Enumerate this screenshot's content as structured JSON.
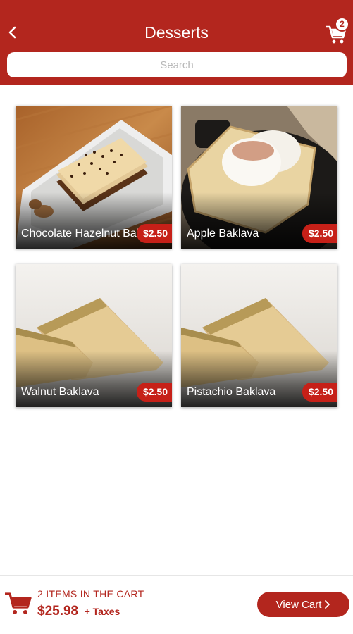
{
  "header": {
    "title": "Desserts",
    "back_icon": "chevron-left-icon",
    "cart_icon": "shopping-cart-icon",
    "cart_count": "2"
  },
  "search": {
    "placeholder": "Search",
    "value": ""
  },
  "products": [
    {
      "name": "Chocolate Hazelnut Baklava",
      "price": "$2.50",
      "image": "chocolate-hazelnut-baklava-photo"
    },
    {
      "name": "Apple Baklava",
      "price": "$2.50",
      "image": "apple-baklava-photo"
    },
    {
      "name": "Walnut Baklava",
      "price": "$2.50",
      "image": "walnut-baklava-photo"
    },
    {
      "name": "Pistachio Baklava",
      "price": "$2.50",
      "image": "pistachio-baklava-photo"
    }
  ],
  "footer": {
    "items_text": "2 ITEMS IN THE CART",
    "total": "$25.98",
    "taxes": "+ Taxes",
    "view_cart": "View Cart",
    "view_cart_icon": "chevron-right-icon"
  },
  "colors": {
    "brand": "#b3261e",
    "price_badge": "#c62018"
  }
}
